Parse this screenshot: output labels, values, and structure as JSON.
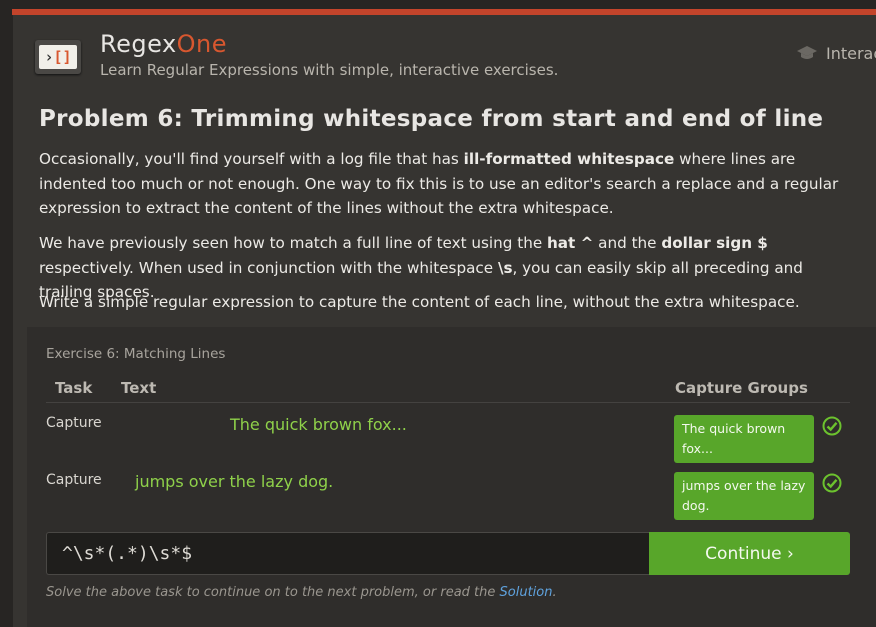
{
  "brand": {
    "name_part1": "Regex",
    "name_part2": "One",
    "tagline": "Learn Regular Expressions with simple, interactive exercises.",
    "logo_text": "›",
    "logo_bracket": "[ ]"
  },
  "nav": {
    "interactive_label": "Interac"
  },
  "problem": {
    "title": "Problem 6: Trimming whitespace from start and end of line",
    "p1_a": "Occasionally, you'll find yourself with a log file that has ",
    "p1_b": "ill-formatted whitespace",
    "p1_c": " where lines are indented too much or not enough. One way to fix this is to use an editor's search a replace and a regular expression to extract the content of the lines without the extra whitespace.",
    "p2_a": "We have previously seen how to match a full line of text using the ",
    "p2_b": "hat ^",
    "p2_c": " and the ",
    "p2_d": "dollar sign $",
    "p2_e": " respectively. When used in conjunction with the whitespace ",
    "p2_f": "\\s",
    "p2_g": ", you can easily skip all preceding and trailing spaces.",
    "p3": "Write a simple regular expression to capture the content of each line, without the extra whitespace."
  },
  "exercise": {
    "title": "Exercise 6: Matching Lines",
    "headers": {
      "task": "Task",
      "text": "Text",
      "capture_groups": "Capture Groups"
    },
    "rows": [
      {
        "task": "Capture",
        "text": "The quick brown fox...",
        "capture": "The quick brown fox..."
      },
      {
        "task": "Capture",
        "text": "jumps over the lazy dog.",
        "capture": "jumps over the lazy dog."
      }
    ],
    "input_value": "^\\s*(.*)\\s*$",
    "continue_label": "Continue ›",
    "hint_prefix": "Solve the above task to continue on to the next problem, or read the ",
    "hint_link": "Solution",
    "hint_suffix": "."
  },
  "colors": {
    "accent": "#d8572f",
    "success": "#58a62a",
    "match_text": "#8fd14a",
    "link": "#5fa2dd"
  }
}
